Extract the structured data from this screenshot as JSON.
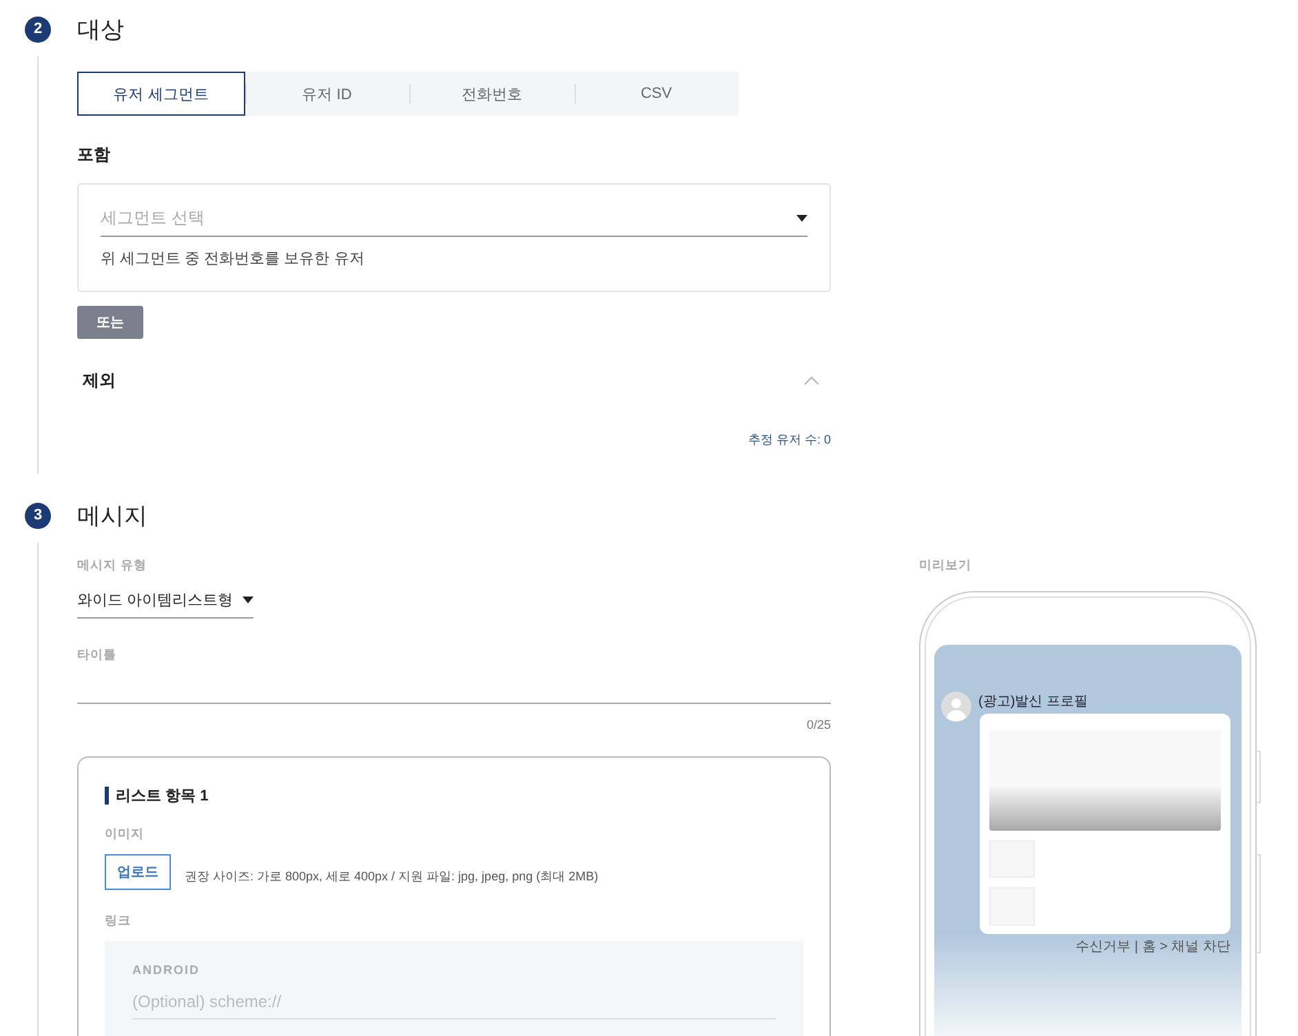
{
  "target": {
    "number": "2",
    "title": "대상",
    "tabs": [
      {
        "label": "유저 세그먼트",
        "selected": true
      },
      {
        "label": "유저 ID",
        "selected": false
      },
      {
        "label": "전화번호",
        "selected": false
      },
      {
        "label": "CSV",
        "selected": false
      }
    ],
    "include": {
      "label": "포함",
      "select": {
        "placeholder": "세그먼트 선택"
      },
      "note": "위 세그먼트 중 전화번호를 보유한 유저"
    },
    "or_button": "또는",
    "exclude": {
      "label": "제외",
      "expanded": true
    },
    "estimate": "추정 유저 수: 0"
  },
  "message": {
    "number": "3",
    "title": "메시지",
    "type": {
      "label": "메시지 유형",
      "value": "와이드 아이템리스트형"
    },
    "title_field": {
      "label": "타이틀",
      "counter": "0/25"
    },
    "list_item": {
      "heading": "리스트 항목 1",
      "image": {
        "label": "이미지",
        "upload_button": "업로드",
        "hint": "권장 사이즈: 가로 800px, 세로 400px / 지원 파일: jpg, jpeg, png (최대 2MB)"
      },
      "link": {
        "label": "링크",
        "android": {
          "label": "ANDROID",
          "placeholder": "(Optional) scheme://"
        }
      }
    }
  },
  "preview": {
    "label": "미리보기",
    "sender": "(광고)발신 프로필",
    "footer": "수신거부 | 홈 > 채널 차단"
  }
}
